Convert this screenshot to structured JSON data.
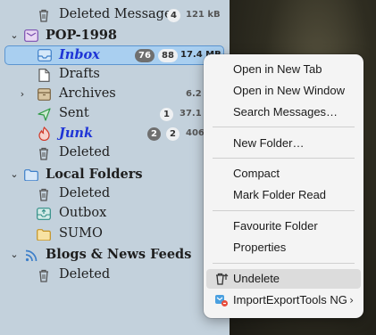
{
  "folders": [
    {
      "key": "deleted_messages",
      "label": "Deleted Messages",
      "icon": "trash-icon",
      "count": "4",
      "size": "121 kB"
    },
    {
      "key": "pop1998",
      "label": "POP-1998",
      "icon": "pop-account-icon",
      "twisty": "expanded"
    },
    {
      "key": "inbox",
      "label": "Inbox",
      "icon": "inbox-icon",
      "unread": "76",
      "count": "88",
      "size": "17.4 MB"
    },
    {
      "key": "drafts",
      "label": "Drafts",
      "icon": "drafts-icon"
    },
    {
      "key": "archives",
      "label": "Archives",
      "icon": "archive-icon",
      "twisty": "collapsed",
      "size": "6.2"
    },
    {
      "key": "sent",
      "label": "Sent",
      "icon": "sent-icon",
      "count": "1",
      "size": "37.1"
    },
    {
      "key": "junk",
      "label": "Junk",
      "icon": "junk-icon",
      "unread": "2",
      "count": "2",
      "size": "406"
    },
    {
      "key": "deleted_pop",
      "label": "Deleted",
      "icon": "trash-icon"
    },
    {
      "key": "local_folders",
      "label": "Local Folders",
      "icon": "local-folders-icon",
      "twisty": "expanded"
    },
    {
      "key": "deleted_local",
      "label": "Deleted",
      "icon": "trash-icon"
    },
    {
      "key": "outbox",
      "label": "Outbox",
      "icon": "outbox-icon"
    },
    {
      "key": "sumo",
      "label": "SUMO",
      "icon": "folder-icon"
    },
    {
      "key": "blogs",
      "label": "Blogs & News Feeds",
      "icon": "rss-icon",
      "twisty": "expanded"
    },
    {
      "key": "deleted_feeds",
      "label": "Deleted",
      "icon": "trash-icon"
    }
  ],
  "context_menu": {
    "items": [
      {
        "label": "Open in New Tab"
      },
      {
        "label": "Open in New Window"
      },
      {
        "label": "Search Messages…"
      },
      {
        "label": "New Folder…"
      },
      {
        "label": "Compact"
      },
      {
        "label": "Mark Folder Read"
      },
      {
        "label": "Favourite Folder"
      },
      {
        "label": "Properties"
      },
      {
        "label": "Undelete",
        "icon": "undelete-icon",
        "hovered": true
      },
      {
        "label": "ImportExportTools NG",
        "icon": "import-export-icon",
        "submenu": true
      }
    ]
  },
  "colors": {
    "pane_background": "#c3d1dc",
    "selection_background": "#a9cff0",
    "selection_border": "#5c95d0",
    "junk_label": "#1f35d6",
    "menu_background": "#f4f4f4",
    "menu_hover": "#dcdcdc"
  }
}
